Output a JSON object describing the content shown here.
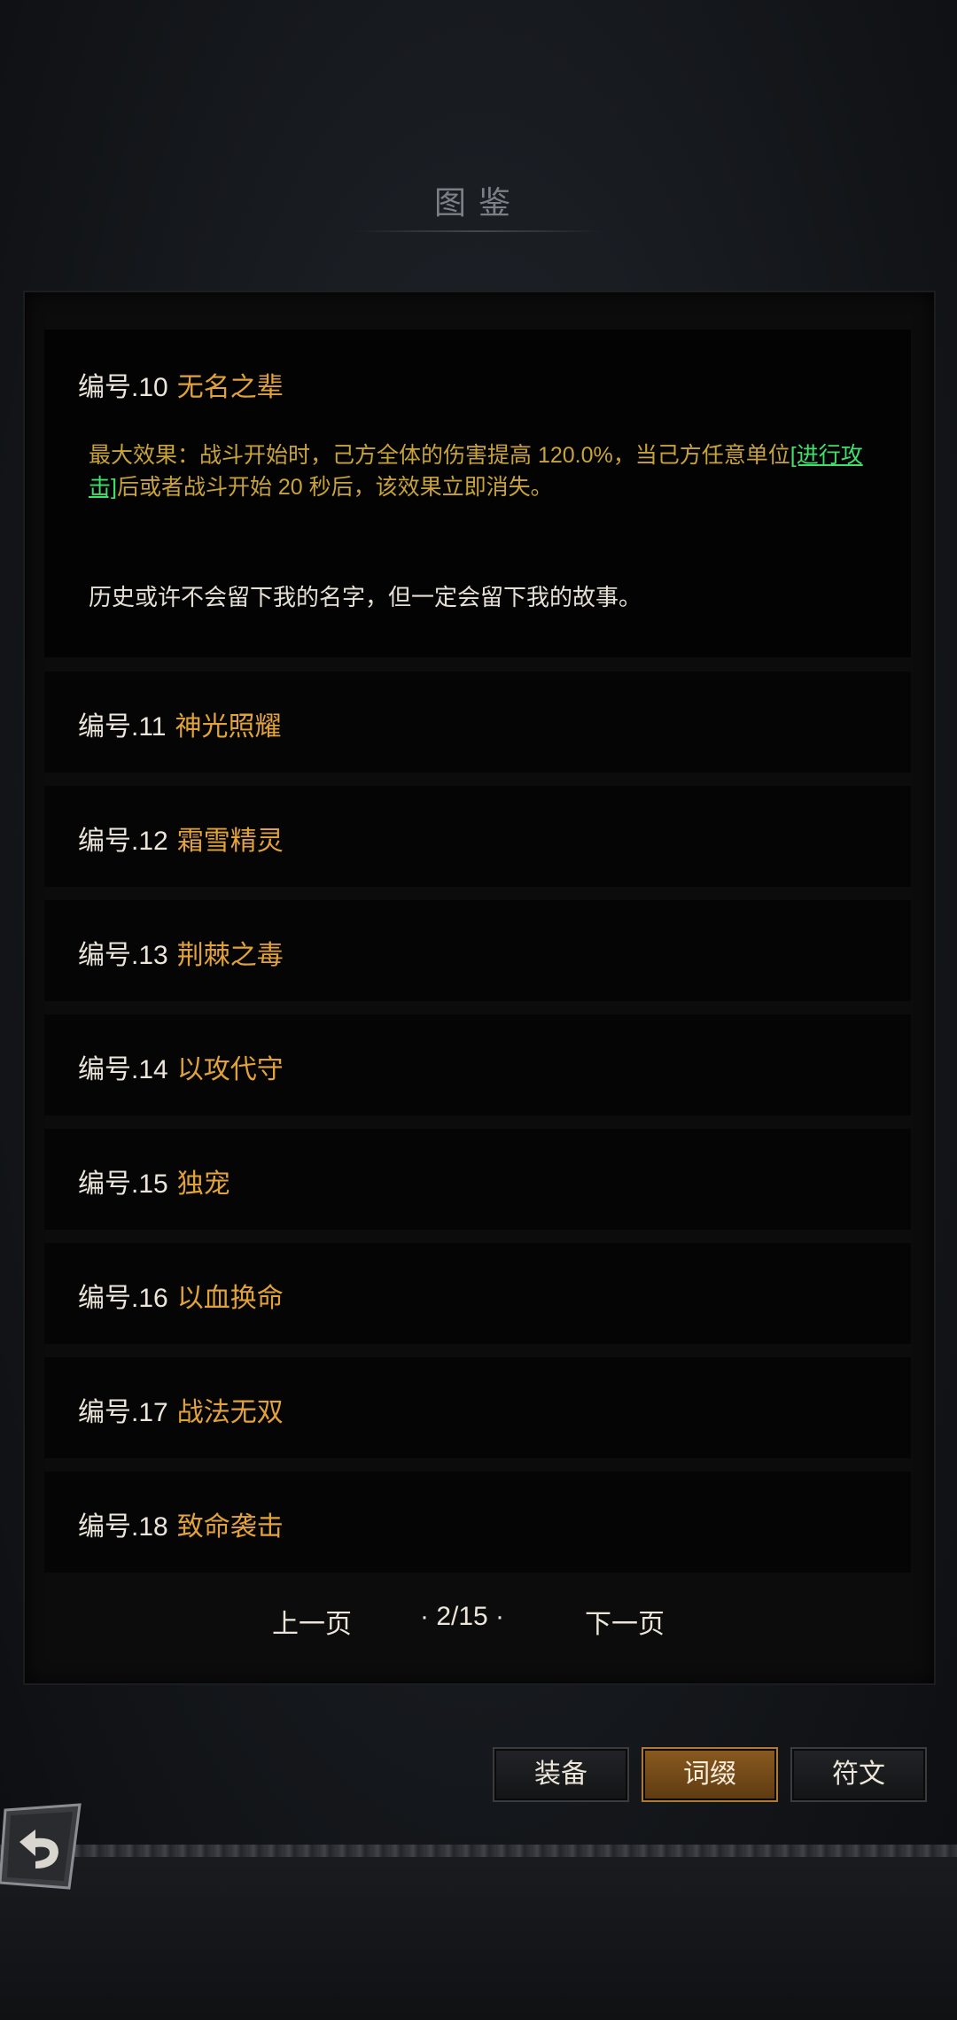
{
  "title": "图鉴",
  "items": [
    {
      "num": "编号.10",
      "name": "无名之辈",
      "effect_pre": "最大效果：战斗开始时，己方全体的伤害提高 120.0%，当己方任意单位",
      "effect_link": "[进行攻击]",
      "effect_post": "后或者战斗开始 20 秒后，该效果立即消失。",
      "lore": "历史或许不会留下我的名字，但一定会留下我的故事。"
    },
    {
      "num": "编号.11",
      "name": "神光照耀"
    },
    {
      "num": "编号.12",
      "name": "霜雪精灵"
    },
    {
      "num": "编号.13",
      "name": "荆棘之毒"
    },
    {
      "num": "编号.14",
      "name": "以攻代守"
    },
    {
      "num": "编号.15",
      "name": "独宠"
    },
    {
      "num": "编号.16",
      "name": "以血换命"
    },
    {
      "num": "编号.17",
      "name": "战法无双"
    },
    {
      "num": "编号.18",
      "name": "致命袭击"
    }
  ],
  "pager": {
    "prev": "上一页",
    "page": "· 2/15 ·",
    "next": "下一页"
  },
  "tabs": [
    {
      "label": "装备",
      "active": false
    },
    {
      "label": "词缀",
      "active": true
    },
    {
      "label": "符文",
      "active": false
    }
  ],
  "colors": {
    "accent_gold": "#e2a23a",
    "effect": "#c8a23a",
    "link_green": "#3fe06a",
    "tab_active": "#8a5a1f"
  },
  "icons": {
    "back": "back-arrow-icon"
  }
}
